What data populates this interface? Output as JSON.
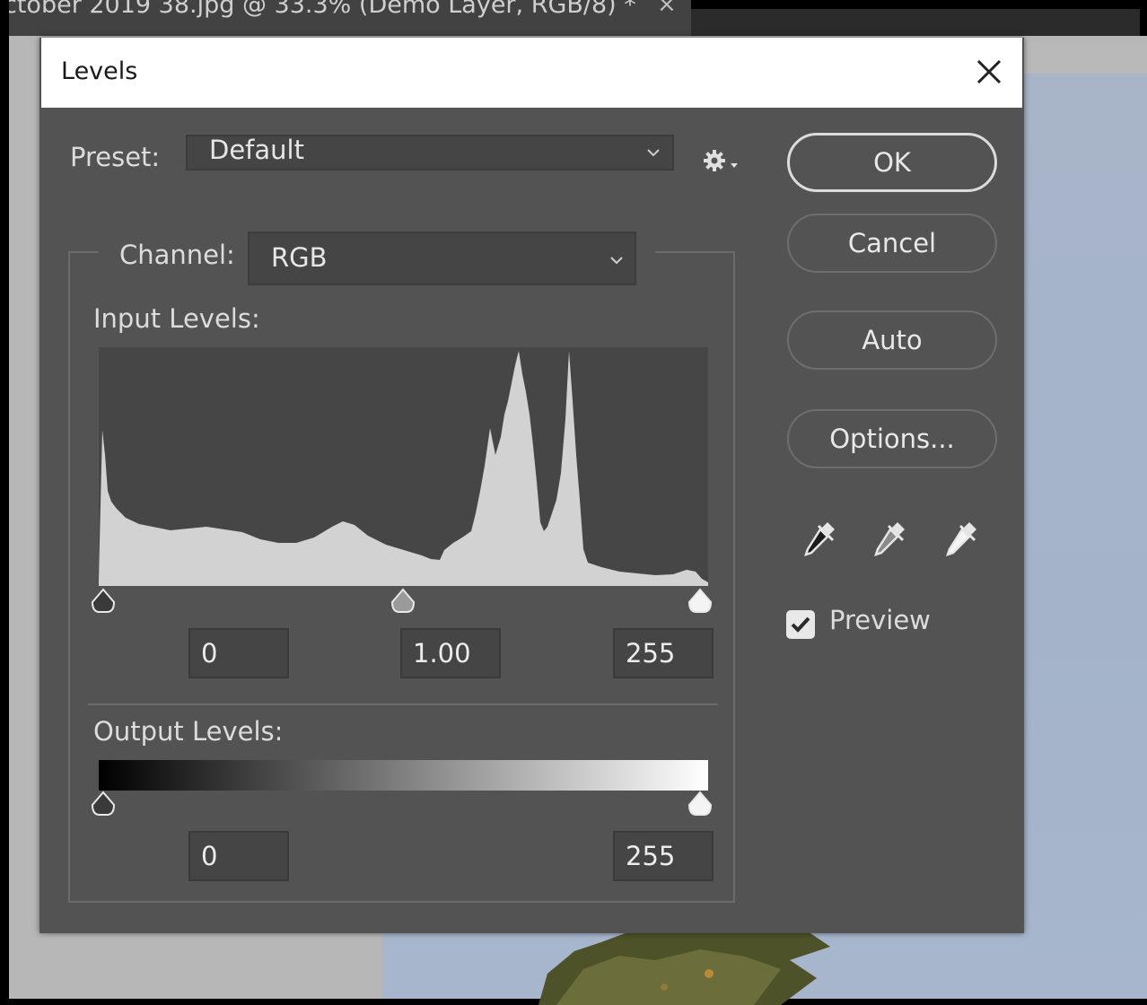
{
  "document_tab": {
    "title": "ctober 2019 38.jpg @ 33.3% (Demo Layer, RGB/8) *",
    "close_glyph": "×"
  },
  "dialog": {
    "title": "Levels",
    "preset": {
      "label": "Preset:",
      "value": "Default"
    },
    "channel": {
      "label": "Channel:",
      "value": "RGB"
    },
    "input_levels": {
      "label": "Input Levels:",
      "black": "0",
      "gamma": "1.00",
      "white": "255"
    },
    "output_levels": {
      "label": "Output Levels:",
      "black": "0",
      "white": "255"
    },
    "buttons": {
      "ok": "OK",
      "cancel": "Cancel",
      "auto": "Auto",
      "options": "Options..."
    },
    "eyedroppers": [
      "black-point-eyedropper-icon",
      "gray-point-eyedropper-icon",
      "white-point-eyedropper-icon"
    ],
    "preview": {
      "label": "Preview",
      "checked": true
    }
  },
  "colors": {
    "dialog_bg": "#535353",
    "field_bg": "#454545",
    "histogram_bg": "#464646",
    "histogram_fill": "#d2d2d2",
    "photo_sky": "#a8b5c9"
  }
}
